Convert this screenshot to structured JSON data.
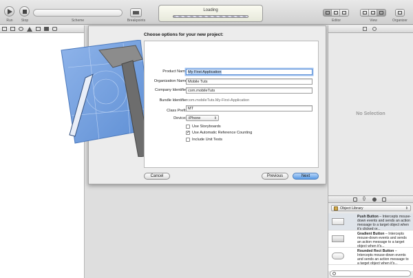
{
  "toolbar": {
    "run_label": "Run",
    "stop_label": "Stop",
    "scheme_label": "Scheme",
    "breakpoints_label": "Breakpoints",
    "activity_text": "Loading",
    "editor_label": "Editor",
    "view_label": "View",
    "organizer_label": "Organizer"
  },
  "sheet": {
    "title": "Choose options for your new project:",
    "fields": {
      "product_name_label": "Product Name",
      "product_name_value": "My First Application",
      "organization_name_label": "Organization Name",
      "organization_name_value": "Mobile Tuts",
      "company_identifier_label": "Company Identifier",
      "company_identifier_value": "com.mobileTuts",
      "bundle_identifier_label": "Bundle Identifier",
      "bundle_identifier_value": "com.mobileTuts.My-First-Application",
      "class_prefix_label": "Class Prefix",
      "class_prefix_value": "MT",
      "devices_label": "Devices",
      "devices_value": "iPhone"
    },
    "options": {
      "use_storyboards": "Use Storyboards",
      "use_arc": "Use Automatic Reference Counting",
      "include_unit_tests": "Include Unit Tests"
    },
    "buttons": {
      "cancel": "Cancel",
      "previous": "Previous",
      "next": "Next"
    }
  },
  "inspector": {
    "no_selection": "No Selection"
  },
  "library": {
    "selector_value": "Object Library",
    "items": [
      {
        "name": "Push Button",
        "desc": " – Intercepts mouse-down events and sends an action message to a target object when it's clicked or..."
      },
      {
        "name": "Gradient Button",
        "desc": " – Intercepts mouse-down events and sends an action message to a target object when it's..."
      },
      {
        "name": "Rounded Rect Button",
        "desc": " – Intercepts mouse-down events and sends an action message to a target object when it's..."
      }
    ]
  },
  "colors": {
    "accent_blue": "#5a9be6",
    "blueprint": "#6f9bd8"
  }
}
